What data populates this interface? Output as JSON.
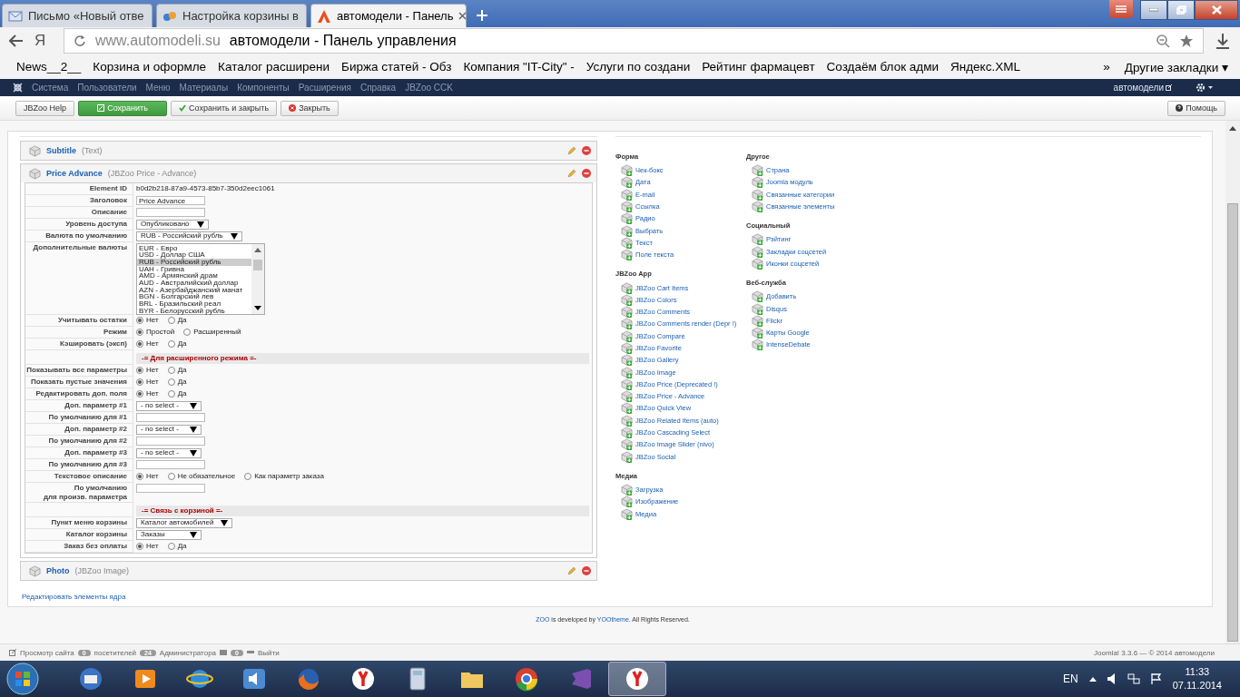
{
  "browser": {
    "tabs": [
      {
        "title": "Письмо «Новый отве",
        "kind": "mail",
        "selected": false
      },
      {
        "title": "Настройка корзины в",
        "kind": "jbzoo",
        "selected": false
      },
      {
        "title": "автомодели - Панель",
        "kind": "site",
        "selected": true
      }
    ],
    "yandex_button": "Я",
    "address": {
      "domain": "www.automodeli.su",
      "title": "автомодели - Панель управления"
    },
    "bookmarks": [
      "News__2__",
      "Корзина и оформле",
      "Каталог расширени",
      "Биржа статей - Обз",
      "Компания \"IT-City\" -",
      "Услуги по создани",
      "Рейтинг фармацевт",
      "Создаём блок адми",
      "Яндекс.XML"
    ],
    "more_bookmarks": "»",
    "other_bookmarks": "Другие закладки ▾"
  },
  "admin_menu": {
    "items": [
      "Система",
      "Пользователи",
      "Меню",
      "Материалы",
      "Компоненты",
      "Расширения",
      "Справка",
      "JBZoo CCK"
    ],
    "site_link": "автомодели"
  },
  "toolbar": {
    "buttons": [
      {
        "label": "JBZoo Help",
        "kind": "plain"
      },
      {
        "label": "Сохранить",
        "kind": "save"
      },
      {
        "label": "Сохранить и закрыть",
        "kind": "check"
      },
      {
        "label": "Закрыть",
        "kind": "close"
      }
    ],
    "help": "Помощь"
  },
  "elements": [
    {
      "name": "Subtitle",
      "type": "(Text)",
      "expanded": false
    },
    {
      "name": "Price Advance",
      "type": "(JBZoo Price - Advance)",
      "expanded": true,
      "fields": [
        {
          "kind": "text",
          "label": "Element ID",
          "value": "b0d2b218-87a9-4573-85b7-350d2eec1061"
        },
        {
          "kind": "input",
          "label": "Заголовок",
          "value": "Price Advance"
        },
        {
          "kind": "input",
          "label": "Описание"
        },
        {
          "kind": "select",
          "label": "Уровень доступа",
          "value": "Опубликовано"
        },
        {
          "kind": "select",
          "label": "Валюта по умолчанию",
          "value": "RUB - Российский рубль"
        },
        {
          "kind": "listbox",
          "label": "Дополнительные валюты",
          "options": [
            {
              "label": "EUR - Евро",
              "selected": false
            },
            {
              "label": "USD - Доллар США",
              "selected": false
            },
            {
              "label": "RUB - Российский рубль",
              "selected": true
            },
            {
              "label": "UAH - Гривна",
              "selected": false
            },
            {
              "label": "AMD - Армянский драм",
              "selected": false
            },
            {
              "label": "AUD - Австралийский доллар",
              "selected": false
            },
            {
              "label": "AZN - Азербайджанский манат",
              "selected": false
            },
            {
              "label": "BGN - Болгарский лев",
              "selected": false
            },
            {
              "label": "BRL - Бразильский реал",
              "selected": false
            },
            {
              "label": "BYR - Белорусский рубль",
              "selected": false
            }
          ]
        },
        {
          "kind": "radio",
          "label": "Учитывать остатки",
          "options": [
            {
              "label": "Нет",
              "selected": true
            },
            {
              "label": "Да",
              "selected": false
            }
          ]
        },
        {
          "kind": "radio",
          "label": "Режим",
          "options": [
            {
              "label": "Простой",
              "selected": true
            },
            {
              "label": "Расширенный",
              "selected": false
            }
          ]
        },
        {
          "kind": "radio",
          "label": "Кэшировать (эксп)",
          "options": [
            {
              "label": "Нет",
              "selected": true
            },
            {
              "label": "Да",
              "selected": false
            }
          ]
        },
        {
          "kind": "section",
          "title": "-= Для расширенного режима =-"
        },
        {
          "kind": "radio",
          "label": "Показывать все параметры",
          "options": [
            {
              "label": "Нет",
              "selected": true
            },
            {
              "label": "Да",
              "selected": false
            }
          ]
        },
        {
          "kind": "radio",
          "label": "Показать пустые значения",
          "options": [
            {
              "label": "Нет",
              "selected": true
            },
            {
              "label": "Да",
              "selected": false
            }
          ]
        },
        {
          "kind": "radio",
          "label": "Редактировать доп. поля",
          "options": [
            {
              "label": "Нет",
              "selected": true
            },
            {
              "label": "Да",
              "selected": false
            }
          ]
        },
        {
          "kind": "select",
          "label": "Доп. параметр #1",
          "value": "- no select -"
        },
        {
          "kind": "input",
          "label": "По умолчанию для #1"
        },
        {
          "kind": "select",
          "label": "Доп. параметр #2",
          "value": "- no select -"
        },
        {
          "kind": "input",
          "label": "По умолчанию для #2"
        },
        {
          "kind": "select",
          "label": "Доп. параметр #3",
          "value": "- no select -"
        },
        {
          "kind": "input",
          "label": "По умолчанию для #3"
        },
        {
          "kind": "radio",
          "label": "Текстовое описание",
          "options": [
            {
              "label": "Нет",
              "selected": true
            },
            {
              "label": "Не обязательное",
              "selected": false
            },
            {
              "label": "Как параметр заказа",
              "selected": false
            }
          ]
        },
        {
          "kind": "input",
          "label": "По умолчанию\nдля произв. параметра"
        },
        {
          "kind": "section",
          "title": "-= Связь с корзиной =-"
        },
        {
          "kind": "select",
          "label": "Пункт меню корзины",
          "value": "Каталог автомобилей"
        },
        {
          "kind": "select",
          "label": "Каталог корзины",
          "value": "Заказы"
        },
        {
          "kind": "radio",
          "label": "Заказ без оплаты",
          "options": [
            {
              "label": "Нет",
              "selected": true
            },
            {
              "label": "Да",
              "selected": false
            }
          ]
        }
      ]
    },
    {
      "name": "Photo",
      "type": "(JBZoo Image)",
      "expanded": false
    }
  ],
  "core_link": "Редактировать элементы ядра",
  "library": {
    "columns": [
      [
        {
          "title": "Форма",
          "items": [
            "Чек-бокс",
            "Дата",
            "E-mail",
            "Ссылка",
            "Радио",
            "Выбрать",
            "Текст",
            "Поле текста"
          ]
        },
        {
          "title": "JBZoo App",
          "items": [
            "JBZoo Cart Items",
            "JBZoo Colors",
            "JBZoo Comments",
            "JBZoo Comments render (Depr !)",
            "JBZoo Compare",
            "JBZoo Favorite",
            "JBZoo Gallery",
            "JBZoo Image",
            "JBZoo Price (Deprecated !)",
            "JBZoo Price - Advance",
            "JBZoo Quick View",
            "JBZoo Related Items (auto)",
            "JBZoo Cascading Select",
            "JBZoo Image Slider (nivo)",
            "JBZoo Social"
          ]
        },
        {
          "title": "Медиа",
          "items": [
            "Загрузка",
            "Изображение",
            "Медиа"
          ]
        }
      ],
      [
        {
          "title": "Другое",
          "items": [
            "Страна",
            "Joomla модуль",
            "Связанные категории",
            "Связанные элементы"
          ]
        },
        {
          "title": "Социальный",
          "items": [
            "Рэйтинг",
            "Закладки соцсетей",
            "Иконки соцсетей"
          ]
        },
        {
          "title": "Веб-служба",
          "items": [
            "Добавить",
            "Disqus",
            "Flickr",
            "Карты Google",
            "IntenseDebate"
          ]
        }
      ]
    ]
  },
  "footer": {
    "link1": "ZOO",
    "text1": " is developed by ",
    "link2": "YOOtheme",
    "text2": ". All Rights Reserved."
  },
  "status_bar": {
    "preview": "Просмотр сайта",
    "visitors_count": "0",
    "visitors": "посетителей",
    "admins_count": "24",
    "admins": "Администратора",
    "messages_count": "0",
    "logout": "Выйти",
    "version": "Joomla! 3.3.6 — © 2014 автомодели"
  },
  "taskbar": {
    "apps": [
      {
        "kind": "mail",
        "selected": false
      },
      {
        "kind": "player",
        "selected": false
      },
      {
        "kind": "ie",
        "selected": false
      },
      {
        "kind": "speaker",
        "selected": false
      },
      {
        "kind": "firefox",
        "selected": false
      },
      {
        "kind": "yandex",
        "selected": false
      },
      {
        "kind": "calculator",
        "selected": false
      },
      {
        "kind": "folder",
        "selected": false
      },
      {
        "kind": "chrome",
        "selected": false
      },
      {
        "kind": "vs",
        "selected": false
      },
      {
        "kind": "yandex",
        "selected": true
      }
    ],
    "language": "EN",
    "time": "11:33",
    "date": "07.11.2014"
  }
}
